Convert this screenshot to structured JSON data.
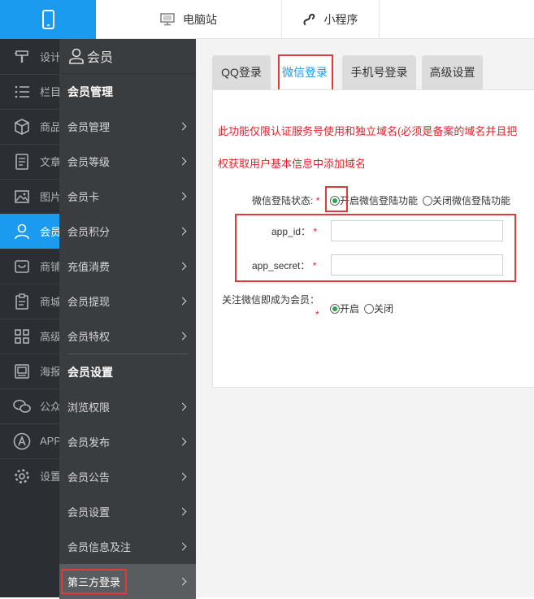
{
  "topbar": {
    "mobile_icon": "phone-icon",
    "pc_label": "电脑站",
    "mini_label": "小程序"
  },
  "rail": {
    "items": [
      {
        "label": "设计",
        "icon": "design-icon"
      },
      {
        "label": "栏目",
        "icon": "list-icon"
      },
      {
        "label": "商品",
        "icon": "box-icon"
      },
      {
        "label": "文章",
        "icon": "article-icon"
      },
      {
        "label": "图片",
        "icon": "image-icon"
      },
      {
        "label": "会员",
        "icon": "user-icon"
      },
      {
        "label": "商铺",
        "icon": "shop-icon"
      },
      {
        "label": "商城",
        "icon": "clipboard-icon"
      },
      {
        "label": "高级",
        "icon": "grid-icon"
      },
      {
        "label": "海报",
        "icon": "poster-icon"
      },
      {
        "label": "公众",
        "icon": "wechat-icon"
      },
      {
        "label": "APP",
        "icon": "app-icon"
      },
      {
        "label": "设置",
        "icon": "gear-icon"
      }
    ]
  },
  "menu": {
    "title": "会员",
    "group1": "会员管理",
    "group1_items": [
      "会员管理",
      "会员等级",
      "会员卡",
      "会员积分",
      "充值消费",
      "会员提现",
      "会员特权"
    ],
    "group2": "会员设置",
    "group2_items": [
      "浏览权限",
      "会员发布",
      "会员公告",
      "会员设置",
      "会员信息及注",
      "第三方登录"
    ]
  },
  "tabs": [
    "QQ登录",
    "微信登录",
    "手机号登录",
    "高级设置"
  ],
  "panel": {
    "warning_line1": "此功能仅限认证服务号使用和独立域名(必须是备案的域名并且把",
    "warning_line2": "权获取用户基本信息中添加域名",
    "login_status_label": "微信登陆状态:",
    "login_on": "开启微信登陆功能",
    "login_off": "关闭微信登陆功能",
    "app_id_label": "app_id：",
    "app_id_value": "",
    "app_secret_label": "app_secret：",
    "app_secret_value": "",
    "follow_label": "关注微信即成为会员：",
    "follow_on": "开启",
    "follow_off": "关闭",
    "required_mark": "*"
  },
  "colors": {
    "accent": "#1b9bf0",
    "highlight": "#e03b3b",
    "warning": "#e4212a"
  }
}
